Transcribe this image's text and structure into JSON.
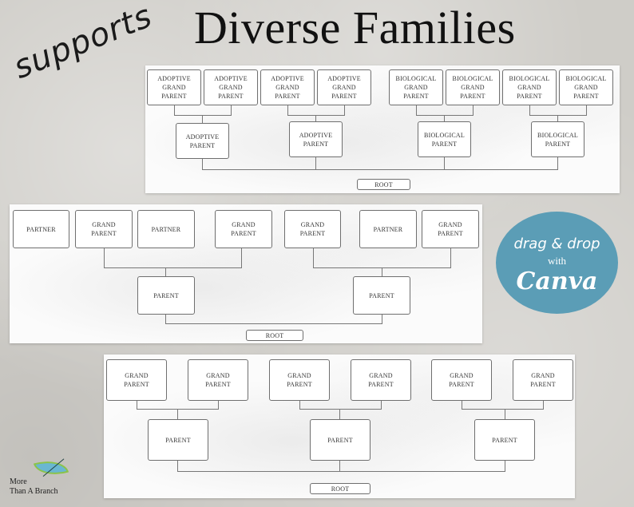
{
  "header": {
    "script_text": "supports",
    "title": "Diverse Families"
  },
  "badge": {
    "line1": "drag & drop",
    "line2": "with",
    "line3": "Canva",
    "color": "#5b9db6"
  },
  "logo": {
    "line1": "More",
    "line2": "Than A Branch",
    "icon": "leaf-icon"
  },
  "panel_top": {
    "grandparents": [
      "ADOPTIVE\nGRAND\nPARENT",
      "ADOPTIVE\nGRAND\nPARENT",
      "ADOPTIVE\nGRAND\nPARENT",
      "ADOPTIVE\nGRAND\nPARENT",
      "BIOLOGICAL\nGRAND\nPARENT",
      "BIOLOGICAL\nGRAND\nPARENT",
      "BIOLOGICAL\nGRAND\nPARENT",
      "BIOLOGICAL\nGRAND\nPARENT"
    ],
    "parents": [
      "ADOPTIVE\nPARENT",
      "ADOPTIVE\nPARENT",
      "BIOLOGICAL\nPARENT",
      "BIOLOGICAL\nPARENT"
    ],
    "root": "ROOT"
  },
  "panel_middle": {
    "top_row": [
      "PARTNER",
      "GRAND\nPARENT",
      "PARTNER",
      "GRAND\nPARENT",
      "GRAND\nPARENT",
      "PARTNER",
      "GRAND\nPARENT"
    ],
    "parents": [
      "PARENT",
      "PARENT"
    ],
    "root": "ROOT"
  },
  "panel_bottom": {
    "grandparents": [
      "GRAND\nPARENT",
      "GRAND\nPARENT",
      "GRAND\nPARENT",
      "GRAND\nPARENT",
      "GRAND\nPARENT",
      "GRAND\nPARENT"
    ],
    "parents": [
      "PARENT",
      "PARENT",
      "PARENT"
    ],
    "root": "ROOT"
  }
}
